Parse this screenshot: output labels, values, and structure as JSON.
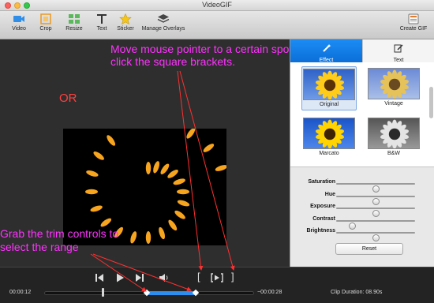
{
  "window": {
    "title": "VideoGIF"
  },
  "toolbar": {
    "items": [
      {
        "label": "Video",
        "icon": "video-icon"
      },
      {
        "label": "Crop",
        "icon": "crop-icon"
      },
      {
        "label": "Resize",
        "icon": "resize-icon"
      },
      {
        "label": "Text",
        "icon": "text-icon"
      },
      {
        "label": "Sticker",
        "icon": "star-icon"
      },
      {
        "label": "Manage Overlays",
        "icon": "layers-icon"
      }
    ],
    "create": {
      "label": "Create GIF",
      "icon": "gif-icon"
    }
  },
  "annotations": {
    "or": "OR",
    "line1": "Move mouse pointer to a certain spot",
    "line2": "click the square brackets.",
    "bottom1": "Grab the trim controls to",
    "bottom2": "select the range"
  },
  "panel": {
    "tabs": [
      {
        "label": "Effect",
        "icon": "wand-icon",
        "active": true
      },
      {
        "label": "Text",
        "icon": "edit-icon",
        "active": false
      }
    ],
    "effects": [
      {
        "label": "Original",
        "selected": true
      },
      {
        "label": "Vintage",
        "selected": false
      },
      {
        "label": "Marcato",
        "selected": false
      },
      {
        "label": "B&W",
        "selected": false
      }
    ],
    "sliders": [
      {
        "label": "Saturation",
        "value": 0.5
      },
      {
        "label": "Hue",
        "value": 0.5
      },
      {
        "label": "Exposure",
        "value": 0.5
      },
      {
        "label": "Contrast",
        "value": 0.2
      },
      {
        "label": "Brightness",
        "value": 0.5
      }
    ],
    "reset_label": "Reset"
  },
  "playback": {
    "current_time": "00:00:12",
    "remaining_time": "−00:00:28",
    "clip_duration": "Clip Duration: 08.90s",
    "playhead": 0.28,
    "trim_start": 0.49,
    "trim_end": 0.72,
    "colors": {
      "range": "#2d8ef0",
      "annotation": "#ff33ff",
      "or": "#ff4040",
      "arrow": "#ff3030"
    }
  }
}
